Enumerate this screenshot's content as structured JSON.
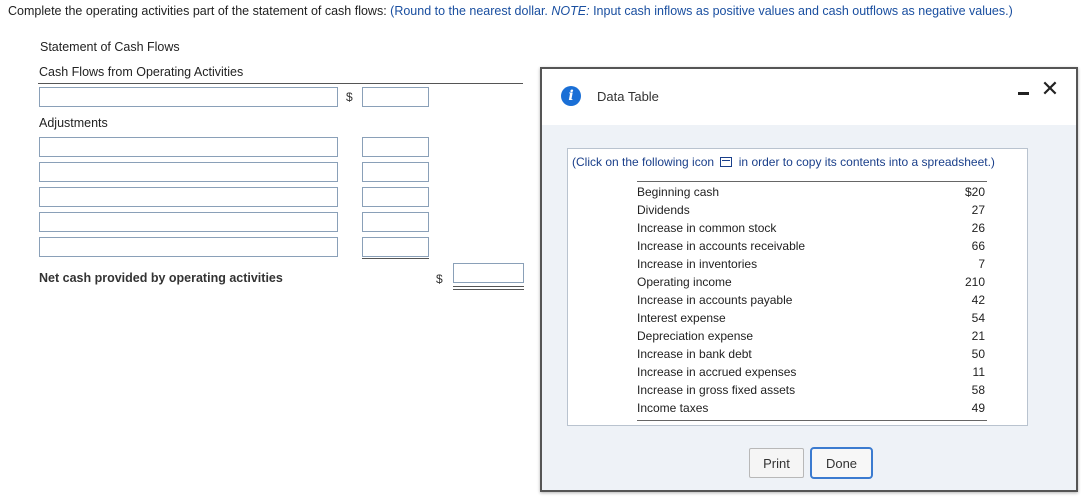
{
  "instruction": {
    "lead": "Complete the operating activities part of the statement of cash flows:",
    "round_note": "(Round to the nearest dollar.",
    "note_label": "NOTE:",
    "note_text": "Input cash inflows as positive values and cash outflows as negative values.)"
  },
  "statement": {
    "title": "Statement of Cash Flows",
    "section_title": "Cash Flows from Operating Activities",
    "currency_symbol": "$",
    "adjustments_label": "Adjustments",
    "net_label": "Net cash provided by operating activities",
    "first_row": {
      "label_value": "",
      "amount_value": ""
    },
    "adjustment_rows": [
      {
        "label_value": "",
        "amount_value": ""
      },
      {
        "label_value": "",
        "amount_value": ""
      },
      {
        "label_value": "",
        "amount_value": ""
      },
      {
        "label_value": "",
        "amount_value": ""
      },
      {
        "label_value": "",
        "amount_value": ""
      }
    ],
    "net_value": ""
  },
  "modal": {
    "info_glyph": "i",
    "title": "Data Table",
    "minimize_label": "minimize",
    "close_glyph": "✕",
    "copy_note_before": "(Click on the following icon",
    "copy_note_after": "in order to copy its contents into a spreadsheet.)",
    "rows": [
      {
        "label": "Beginning cash",
        "value": "$20"
      },
      {
        "label": "Dividends",
        "value": "27"
      },
      {
        "label": "Increase in common stock",
        "value": "26"
      },
      {
        "label": "Increase in accounts receivable",
        "value": "66"
      },
      {
        "label": "Increase in inventories",
        "value": "7"
      },
      {
        "label": "Operating income",
        "value": "210"
      },
      {
        "label": "Increase in accounts payable",
        "value": "42"
      },
      {
        "label": "Interest expense",
        "value": "54"
      },
      {
        "label": "Depreciation expense",
        "value": "21"
      },
      {
        "label": "Increase in bank debt",
        "value": "50"
      },
      {
        "label": "Increase in accrued expenses",
        "value": "11"
      },
      {
        "label": "Increase in gross fixed assets",
        "value": "58"
      },
      {
        "label": "Income taxes",
        "value": "49"
      }
    ],
    "print_label": "Print",
    "done_label": "Done"
  },
  "colors": {
    "accent_blue": "#1a6fd6",
    "instruction_blue": "#1a4fa0",
    "modal_body": "#eef2f7"
  }
}
